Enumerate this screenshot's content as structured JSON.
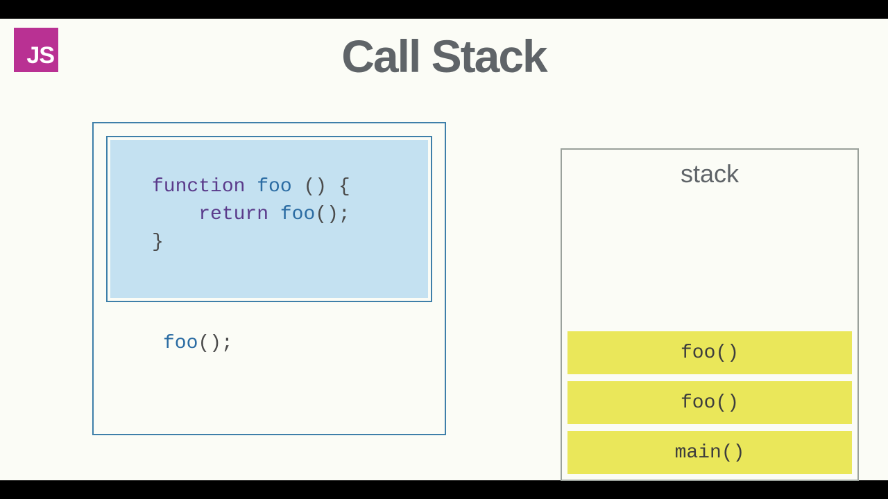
{
  "slide": {
    "title": "Call Stack",
    "logo_text": "JS"
  },
  "code": {
    "highlight": {
      "line1_kw": "function",
      "line1_fn": " foo ",
      "line1_rest": "() {",
      "line2_indent": "    ",
      "line2_kw": "return",
      "line2_fn": " foo",
      "line2_rest": "();",
      "line3": "}"
    },
    "rest": {
      "call_fn": "foo",
      "call_rest": "();"
    }
  },
  "stack": {
    "label": "stack",
    "frames": [
      "foo()",
      "foo()",
      "main()"
    ]
  }
}
